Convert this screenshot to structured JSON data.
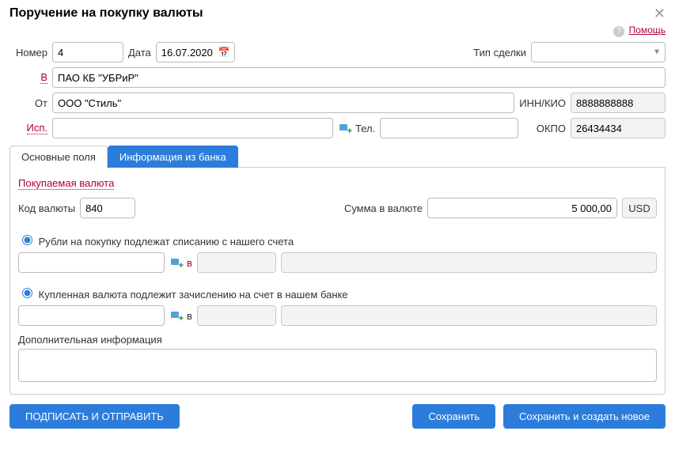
{
  "title": "Поручение на покупку валюты",
  "help": "Помощь",
  "labels": {
    "number": "Номер",
    "date": "Дата",
    "deal_type": "Тип сделки",
    "to_bank": "В",
    "from": "От",
    "inn": "ИНН/КИО",
    "executor": "Исп.",
    "tel": "Тел.",
    "okpo": "ОКПО"
  },
  "fields": {
    "number": "4",
    "date": "16.07.2020",
    "deal_type": "",
    "bank": "ПАО КБ \"УБРиР\"",
    "from": "ООО \"Стиль\"",
    "inn": "8888888888",
    "executor": "",
    "tel": "",
    "okpo": "26434434"
  },
  "tabs": {
    "main": "Основные поля",
    "bank_info": "Информация из банка"
  },
  "currency": {
    "section": "Покупаемая валюта",
    "code_label": "Код валюты",
    "code": "840",
    "amount_label": "Сумма в валюте",
    "amount": "5 000,00",
    "iso": "USD"
  },
  "debit": {
    "radio": "Рубли на покупку подлежат списанию с нашего счета",
    "in": "в",
    "acc": "",
    "curr": "",
    "desc": ""
  },
  "credit": {
    "radio": "Купленная валюта подлежит зачислению на счет в нашем банке",
    "in": "в",
    "acc": "",
    "curr": "",
    "desc": ""
  },
  "extra": {
    "label": "Дополнительная информация",
    "value": ""
  },
  "buttons": {
    "sign_send": "ПОДПИСАТЬ И ОТПРАВИТЬ",
    "save": "Сохранить",
    "save_new": "Сохранить и создать новое"
  }
}
